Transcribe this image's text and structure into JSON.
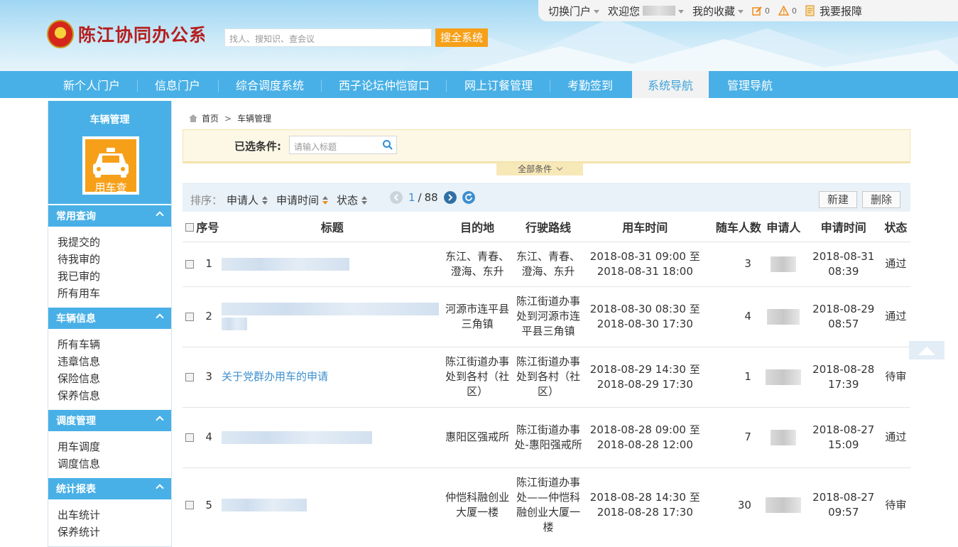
{
  "header": {
    "logo_text": "陈江协同办公系统",
    "search_placeholder": "找人、搜知识、查会议",
    "search_button": "搜全系统"
  },
  "topbar": {
    "switch_portal": "切换门户",
    "welcome": "欢迎您",
    "favorites": "我的收藏",
    "todo_count": "0",
    "alert_count": "0",
    "report_issue": "我要报障"
  },
  "nav": {
    "items": [
      {
        "label": "新个人门户"
      },
      {
        "label": "信息门户"
      },
      {
        "label": "综合调度系统"
      },
      {
        "label": "西子论坛仲恺窗口"
      },
      {
        "label": "网上订餐管理"
      },
      {
        "label": "考勤签到"
      },
      {
        "label": "系统导航"
      },
      {
        "label": "管理导航"
      }
    ],
    "active": "系统导航"
  },
  "sidebar": {
    "title": "车辆管理",
    "tile_label": "用车查",
    "sections": [
      {
        "title": "常用查询",
        "links": [
          "我提交的",
          "待我审的",
          "我已审的",
          "所有用车"
        ]
      },
      {
        "title": "车辆信息",
        "links": [
          "所有车辆",
          "违章信息",
          "保险信息",
          "保养信息"
        ]
      },
      {
        "title": "调度管理",
        "links": [
          "用车调度",
          "调度信息"
        ]
      },
      {
        "title": "统计报表",
        "links": [
          "出车统计",
          "保养统计"
        ]
      }
    ]
  },
  "breadcrumb": {
    "home": "首页",
    "sep": ">",
    "current": "车辆管理"
  },
  "filter": {
    "label": "已选条件:",
    "placeholder": "请输入标题",
    "expand": "全部条件"
  },
  "toolbar": {
    "sort_label": "排序：",
    "sorts": [
      "申请人",
      "申请时间",
      "状态"
    ],
    "page_current": "1",
    "page_sep": "/",
    "page_total": "88",
    "new_button": "新建",
    "delete_button": "删除"
  },
  "table": {
    "headers": [
      "序号",
      "标题",
      "目的地",
      "行驶路线",
      "用车时间",
      "随车人数",
      "申请人",
      "申请时间",
      "状态"
    ],
    "rows": [
      {
        "no": "1",
        "title": "",
        "dest": "东江、青春、澄海、东升",
        "route": "东江、青春、澄海、东升",
        "time": "2018-08-31 09:00 至 2018-08-31 18:00",
        "people": "3",
        "apply_time": "2018-08-31 08:39",
        "status": "通过"
      },
      {
        "no": "2",
        "title": "",
        "dest": "河源市连平县三角镇",
        "route": "陈江街道办事处到河源市连平县三角镇",
        "time": "2018-08-30 08:30 至 2018-08-30 17:30",
        "people": "4",
        "apply_time": "2018-08-29 08:57",
        "status": "通过"
      },
      {
        "no": "3",
        "title": "关于党群办用车的申请",
        "dest": "陈江街道办事处到各村（社区）",
        "route": "陈江街道办事处到各村（社区）",
        "time": "2018-08-29 14:30 至 2018-08-29 17:30",
        "people": "1",
        "apply_time": "2018-08-28 17:39",
        "status": "待审"
      },
      {
        "no": "4",
        "title": "",
        "dest": "惠阳区强戒所",
        "route": "陈江街道办事处-惠阳强戒所",
        "time": "2018-08-28 09:00 至 2018-08-28 12:00",
        "people": "7",
        "apply_time": "2018-08-27 15:09",
        "status": "通过"
      },
      {
        "no": "5",
        "title": "",
        "dest": "仲恺科融创业大厦一楼",
        "route": "陈江街道办事处——仲恺科融创业大厦一楼",
        "time": "2018-08-28 14:30 至 2018-08-28 17:30",
        "people": "30",
        "apply_time": "2018-08-27 09:57",
        "status": "待审"
      }
    ]
  },
  "colors": {
    "nav_blue": "#48b0e6",
    "accent_orange": "#f6a01a",
    "link_blue": "#3d8fcf"
  }
}
